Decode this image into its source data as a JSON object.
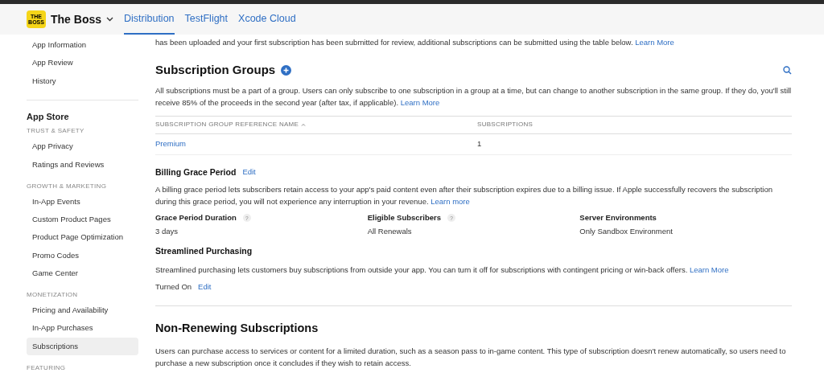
{
  "app": {
    "logo": "THE BOSS",
    "name": "The Boss"
  },
  "tabs": [
    {
      "label": "Distribution",
      "selected": true
    },
    {
      "label": "TestFlight",
      "selected": false
    },
    {
      "label": "Xcode Cloud",
      "selected": false
    }
  ],
  "sidebar": {
    "top_items": [
      {
        "label": "App Information",
        "selected": false
      },
      {
        "label": "App Review",
        "selected": false
      },
      {
        "label": "History",
        "selected": false
      }
    ],
    "section_title": "App Store",
    "groups": [
      {
        "heading": "TRUST & SAFETY",
        "items": [
          {
            "label": "App Privacy",
            "selected": false
          },
          {
            "label": "Ratings and Reviews",
            "selected": false
          }
        ]
      },
      {
        "heading": "GROWTH & MARKETING",
        "items": [
          {
            "label": "In-App Events",
            "selected": false
          },
          {
            "label": "Custom Product Pages",
            "selected": false
          },
          {
            "label": "Product Page Optimization",
            "selected": false
          },
          {
            "label": "Promo Codes",
            "selected": false
          },
          {
            "label": "Game Center",
            "selected": false
          }
        ]
      },
      {
        "heading": "MONETIZATION",
        "items": [
          {
            "label": "Pricing and Availability",
            "selected": false
          },
          {
            "label": "In-App Purchases",
            "selected": false
          },
          {
            "label": "Subscriptions",
            "selected": true
          }
        ]
      },
      {
        "heading": "FEATURING"
      }
    ]
  },
  "intro": {
    "text": "has been uploaded and your first subscription has been submitted for review, additional subscriptions can be submitted using the table below.",
    "link": "Learn More"
  },
  "subscription_groups": {
    "title": "Subscription Groups",
    "text": "All subscriptions must be a part of a group. Users can only subscribe to one subscription in a group at a time, but can change to another subscription in the same group. If they do, you'll still receive 85% of the proceeds in the second year (after tax, if applicable).",
    "link": "Learn More",
    "table": {
      "columns": [
        "SUBSCRIPTION GROUP REFERENCE NAME",
        "SUBSCRIPTIONS"
      ],
      "rows": [
        [
          "Premium",
          "1"
        ]
      ]
    }
  },
  "billing_grace": {
    "title": "Billing Grace Period",
    "edit": "Edit",
    "text": "A billing grace period lets subscribers retain access to your app's paid content even after their subscription expires due to a billing issue. If Apple successfully recovers the subscription during this grace period, you will not experience any interruption in your revenue.",
    "link": "Learn more",
    "fields": [
      {
        "label": "Grace Period Duration",
        "help": "?",
        "value": "3 days"
      },
      {
        "label": "Eligible Subscribers",
        "help": "?",
        "value": "All Renewals"
      },
      {
        "label": "Server Environments",
        "value": "Only Sandbox Environment"
      }
    ]
  },
  "streamlined": {
    "title": "Streamlined Purchasing",
    "text": "Streamlined purchasing lets customers buy subscriptions from outside your app. You can turn it off for subscriptions with contingent pricing or win-back offers.",
    "link": "Learn More",
    "status": "Turned On",
    "edit": "Edit"
  },
  "non_renewing": {
    "title": "Non-Renewing Subscriptions",
    "text": "Users can purchase access to services or content for a limited duration, such as a season pass to in-game content. This type of subscription doesn't renew automatically, so users need to purchase a new subscription once it concludes if they wish to retain access."
  }
}
